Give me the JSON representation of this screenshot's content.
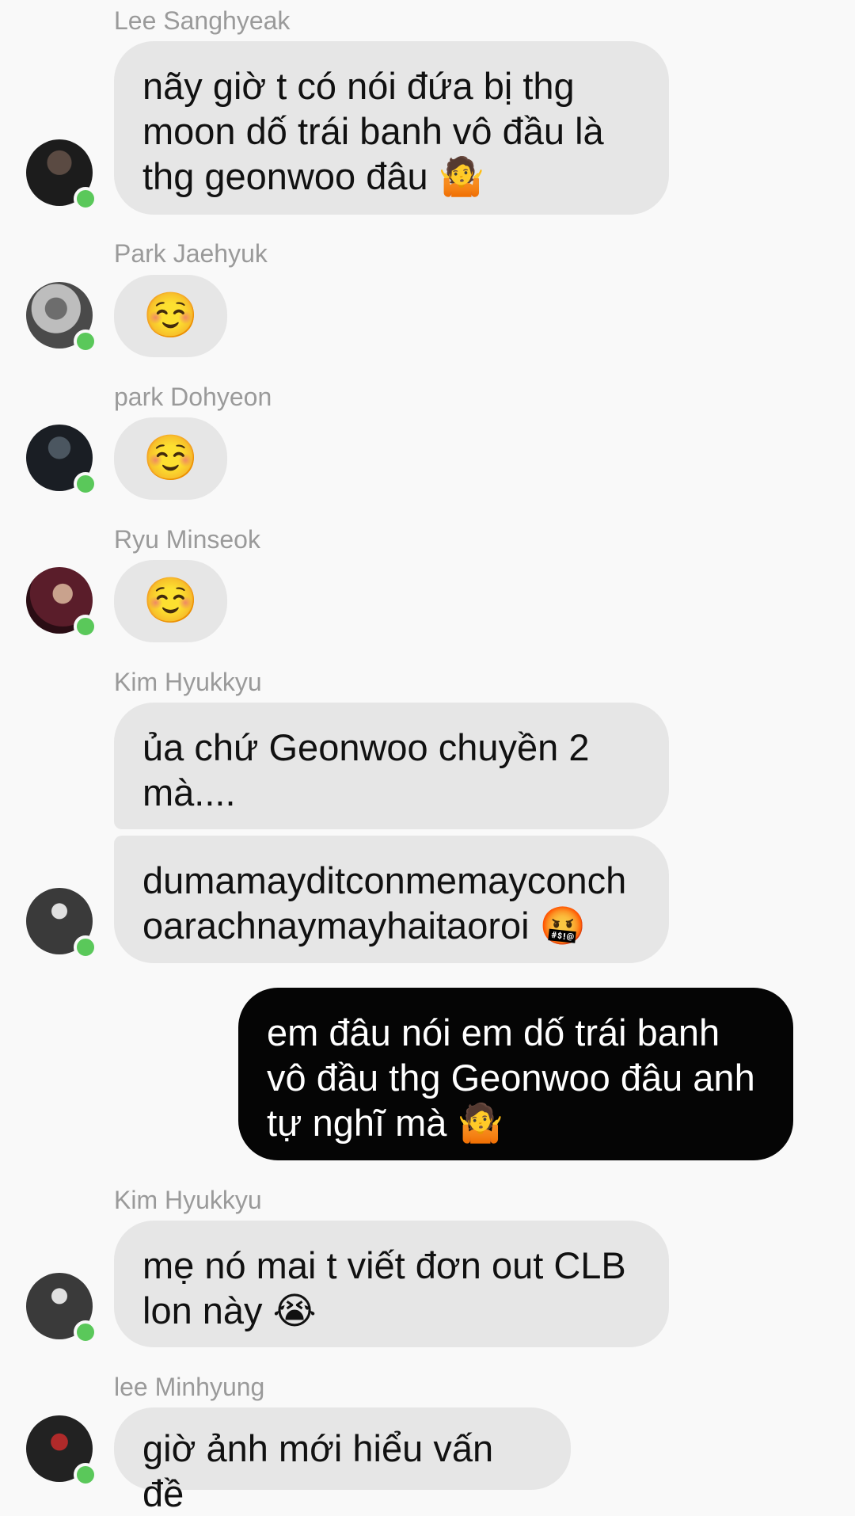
{
  "messages": [
    {
      "sender": "Lee Sanghyeak",
      "text": "nãy giờ t có nói đứa bị thg moon dố trái banh vô đầu là thg geonwoo đâu 🤷"
    },
    {
      "sender": "Park Jaehyuk",
      "text": "☺️"
    },
    {
      "sender": "park Dohyeon",
      "text": "☺️"
    },
    {
      "sender": "Ryu Minseok",
      "text": "☺️"
    },
    {
      "sender": "Kim Hyukkyu",
      "text_1": "ủa chứ Geonwoo chuyền 2 mà....",
      "text_2": "dumamayditconmemayconchoarachnaymayhaitaoroi 🤬"
    },
    {
      "sender": "me",
      "text": "em đâu nói em dố trái banh vô đầu thg Geonwoo đâu anh tự nghĩ mà 🤷"
    },
    {
      "sender": "Kim Hyukkyu",
      "text": "mẹ nó mai t viết đơn out CLB lon này 😭"
    },
    {
      "sender": "lee Minhyung",
      "text": "giờ ảnh mới hiểu vấn đề"
    }
  ],
  "colors": {
    "incoming_bubble": "#e6e6e6",
    "outgoing_bubble": "#050505",
    "online_indicator": "#5ac85a",
    "background": "#f9f9f9"
  }
}
